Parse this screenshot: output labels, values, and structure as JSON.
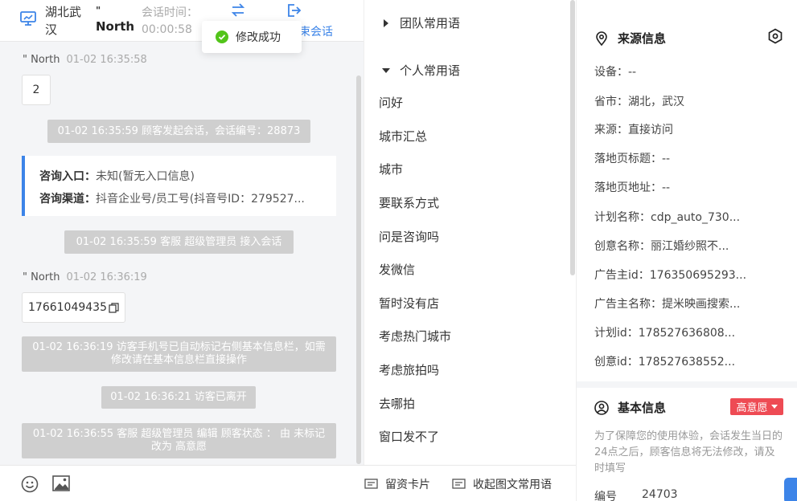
{
  "header": {
    "location": "湖北武汉",
    "name_mark": "\"",
    "name": "North",
    "time_label": "会话时间：",
    "time_value": "00:00:58",
    "end_label": "束会话"
  },
  "toast": {
    "text": "修改成功",
    "color": "#52c41a"
  },
  "messages": {
    "m1_name": "\" North",
    "m1_time": "01-02 16:35:58",
    "m1_text": "2",
    "sys1": "01-02 16:35:59 顾客发起会话，会话编号：28873",
    "card_entry_label": "咨询入口：",
    "card_entry_value": "未知(暂无入口信息)",
    "card_channel_label": "咨询渠道：",
    "card_channel_value": "抖音企业号/员工号(抖音号ID：279527...",
    "sys2": "01-02 16:35:59 客服 超级管理员 接入会话",
    "m2_name": "\" North",
    "m2_time": "01-02 16:36:19",
    "m2_text": "17661049435",
    "sys3": "01-02 16:36:19 访客手机号已自动标记右侧基本信息栏，如需修改请在基本信息栏直接操作",
    "sys4": "01-02 16:36:21 访客已离开",
    "sys5": "01-02 16:36:55 客服 超级管理员 编辑 顾客状态 ： 由 未标记 改为 高意愿"
  },
  "toolbar": {
    "card_label": "留资卡片",
    "phrases_label": "收起图文常用语"
  },
  "phrases": {
    "team_group": "团队常用语",
    "personal_group": "个人常用语",
    "items": [
      "问好",
      "城市汇总",
      "城市",
      "要联系方式",
      "问是咨询吗",
      "发微信",
      "暂时没有店",
      "考虑热门城市",
      "考虑旅拍吗",
      "去哪拍",
      "窗口发不了"
    ]
  },
  "source_info": {
    "title": "来源信息",
    "fields": [
      "设备：--",
      "省市：湖北，武汉",
      "来源：直接访问",
      "落地页标题：--",
      "落地页地址：--",
      "计划名称：cdp_auto_730...",
      "创意名称：丽江婚纱照不...",
      "广告主id：176350695293...",
      "广告主名称：提米映画搜索...",
      "计划id：178527636808...",
      "创意id：178527638552..."
    ]
  },
  "basic_info": {
    "title": "基本信息",
    "status": "高意愿",
    "status_color": "#ee4b54",
    "notice": "为了保障您的使用体验，会话发生当日的24点之后，顾客信息将无法修改，请及时填写",
    "number_label": "编号",
    "number_value": "24703"
  },
  "colors": {
    "accent": "#3c84e8",
    "system_message": "#cfcfcf"
  }
}
